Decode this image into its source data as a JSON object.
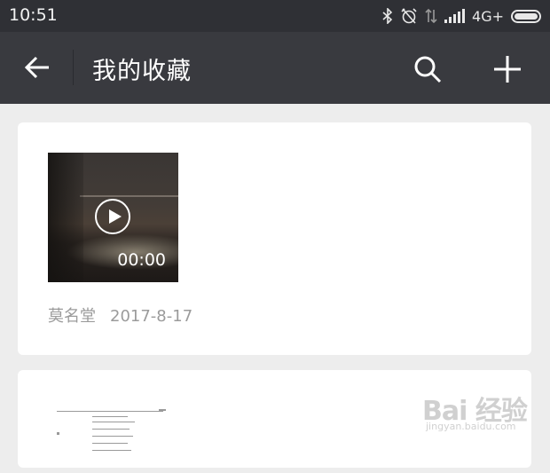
{
  "status_bar": {
    "time": "10:51",
    "network": "4G+",
    "icons": [
      "bluetooth-icon",
      "alarm-off-icon",
      "data-arrows-icon",
      "signal-icon",
      "battery-icon"
    ]
  },
  "nav": {
    "title": "我的收藏",
    "icons": [
      "back-arrow-icon",
      "search-icon",
      "add-icon"
    ]
  },
  "favorites": [
    {
      "type": "video",
      "duration": "00:00",
      "source": "莫名堂",
      "date": "2017-8-17"
    },
    {
      "type": "document"
    }
  ],
  "watermark": {
    "main": "Bai 经验",
    "sub": "jingyan.baidu.com"
  },
  "colors": {
    "status_bar": "#2f3035",
    "nav_bar": "#393a3f",
    "background": "#ededed",
    "card": "#ffffff",
    "meta_text": "#9b9b9b"
  }
}
